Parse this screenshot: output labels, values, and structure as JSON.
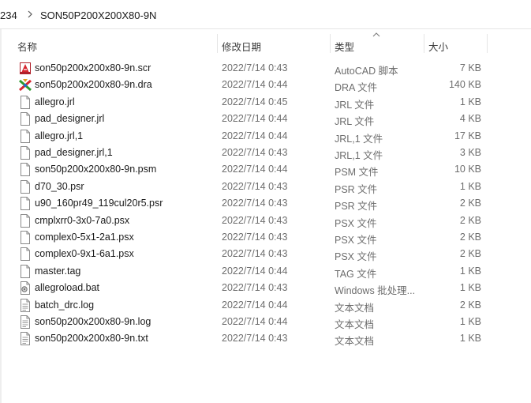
{
  "breadcrumb": {
    "prev": "234",
    "current": "SON50P200X200X80-9N"
  },
  "columns": {
    "name": "名称",
    "date": "修改日期",
    "type": "类型",
    "size": "大小"
  },
  "files": [
    {
      "name": "son50p200x200x80-9n.scr",
      "date": "2022/7/14 0:43",
      "type": "AutoCAD 脚本",
      "size": "7 KB",
      "icon": "autocad-script-icon"
    },
    {
      "name": "son50p200x200x80-9n.dra",
      "date": "2022/7/14 0:44",
      "type": "DRA 文件",
      "size": "140 KB",
      "icon": "allegro-dra-icon"
    },
    {
      "name": "allegro.jrl",
      "date": "2022/7/14 0:45",
      "type": "JRL 文件",
      "size": "1 KB",
      "icon": "file-icon"
    },
    {
      "name": "pad_designer.jrl",
      "date": "2022/7/14 0:44",
      "type": "JRL 文件",
      "size": "4 KB",
      "icon": "file-icon"
    },
    {
      "name": "allegro.jrl,1",
      "date": "2022/7/14 0:44",
      "type": "JRL,1 文件",
      "size": "17 KB",
      "icon": "file-icon"
    },
    {
      "name": "pad_designer.jrl,1",
      "date": "2022/7/14 0:43",
      "type": "JRL,1 文件",
      "size": "3 KB",
      "icon": "file-icon"
    },
    {
      "name": "son50p200x200x80-9n.psm",
      "date": "2022/7/14 0:44",
      "type": "PSM 文件",
      "size": "10 KB",
      "icon": "file-icon"
    },
    {
      "name": "d70_30.psr",
      "date": "2022/7/14 0:43",
      "type": "PSR 文件",
      "size": "1 KB",
      "icon": "file-icon"
    },
    {
      "name": "u90_160pr49_119cul20r5.psr",
      "date": "2022/7/14 0:43",
      "type": "PSR 文件",
      "size": "2 KB",
      "icon": "file-icon"
    },
    {
      "name": "cmplxrr0-3x0-7a0.psx",
      "date": "2022/7/14 0:43",
      "type": "PSX 文件",
      "size": "2 KB",
      "icon": "file-icon"
    },
    {
      "name": "complex0-5x1-2a1.psx",
      "date": "2022/7/14 0:43",
      "type": "PSX 文件",
      "size": "2 KB",
      "icon": "file-icon"
    },
    {
      "name": "complex0-9x1-6a1.psx",
      "date": "2022/7/14 0:43",
      "type": "PSX 文件",
      "size": "2 KB",
      "icon": "file-icon"
    },
    {
      "name": "master.tag",
      "date": "2022/7/14 0:44",
      "type": "TAG 文件",
      "size": "1 KB",
      "icon": "file-icon"
    },
    {
      "name": "allegroload.bat",
      "date": "2022/7/14 0:43",
      "type": "Windows 批处理...",
      "size": "1 KB",
      "icon": "batch-file-icon"
    },
    {
      "name": "batch_drc.log",
      "date": "2022/7/14 0:44",
      "type": "文本文档",
      "size": "2 KB",
      "icon": "text-file-icon"
    },
    {
      "name": "son50p200x200x80-9n.log",
      "date": "2022/7/14 0:44",
      "type": "文本文档",
      "size": "1 KB",
      "icon": "text-file-icon"
    },
    {
      "name": "son50p200x200x80-9n.txt",
      "date": "2022/7/14 0:43",
      "type": "文本文档",
      "size": "1 KB",
      "icon": "text-file-icon"
    }
  ]
}
